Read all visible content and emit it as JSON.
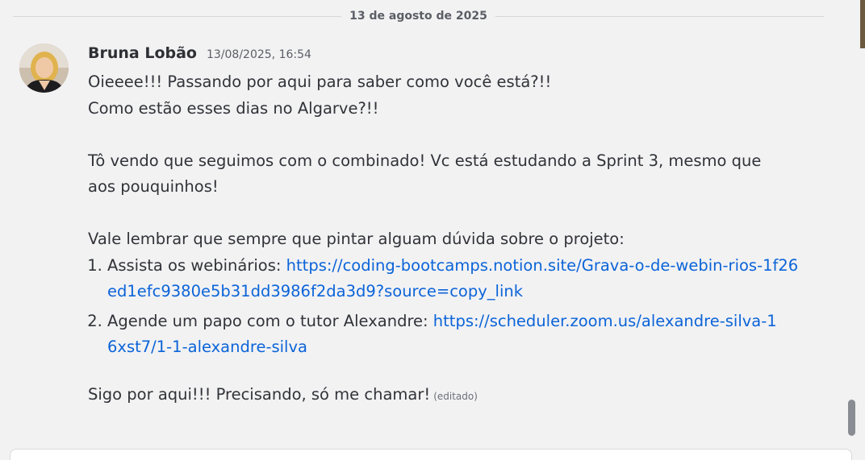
{
  "divider": {
    "date": "13 de agosto de 2025"
  },
  "message": {
    "author": "Bruna Lobão",
    "timestamp": "13/08/2025, 16:54",
    "lines": {
      "l1": "Oieeee!!! Passando por aqui para saber como você está?!!",
      "l2": "Como estão esses dias no Algarve?!!",
      "l3": "Tô vendo que seguimos com o combinado! Vc está estudando a Sprint 3, mesmo que",
      "l4": "aos pouquinhos!",
      "l5": "Vale lembrar que sempre que pintar alguam dúvida sobre o projeto:"
    },
    "list": [
      {
        "text": "Assista os webinários: ",
        "link": "https://coding-bootcamps.notion.site/Grava-o-de-webin-rios-1f26ed1efc9380e5b31dd3986f2da3d9?source=copy_link"
      },
      {
        "text": "Agende um papo com o tutor Alexandre: ",
        "link": "https://scheduler.zoom.us/alexandre-silva-16xst7/1-1-alexandre-silva"
      }
    ],
    "closing": "Sigo por aqui!!! Precisando, só me chamar!",
    "edited_label": "(editado)"
  },
  "colors": {
    "background": "#f2f2f3",
    "link": "#0b64d8",
    "text": "#313338"
  }
}
